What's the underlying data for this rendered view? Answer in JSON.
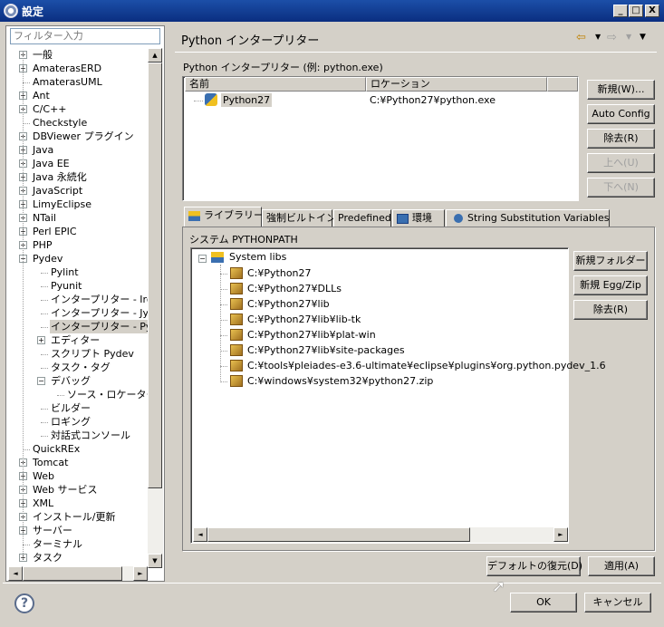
{
  "window": {
    "title": "設定",
    "min": "_",
    "max": "□",
    "close": "X"
  },
  "filter": {
    "placeholder": "フィルター入力"
  },
  "tree": [
    {
      "label": "一般",
      "depth": 0,
      "exp": "+"
    },
    {
      "label": "AmaterasERD",
      "depth": 0,
      "exp": "+"
    },
    {
      "label": "AmaterasUML",
      "depth": 0,
      "exp": ""
    },
    {
      "label": "Ant",
      "depth": 0,
      "exp": "+"
    },
    {
      "label": "C/C++",
      "depth": 0,
      "exp": "+"
    },
    {
      "label": "Checkstyle",
      "depth": 0,
      "exp": ""
    },
    {
      "label": "DBViewer プラグイン",
      "depth": 0,
      "exp": "+"
    },
    {
      "label": "Java",
      "depth": 0,
      "exp": "+"
    },
    {
      "label": "Java EE",
      "depth": 0,
      "exp": "+"
    },
    {
      "label": "Java 永続化",
      "depth": 0,
      "exp": "+"
    },
    {
      "label": "JavaScript",
      "depth": 0,
      "exp": "+"
    },
    {
      "label": "LimyEclipse",
      "depth": 0,
      "exp": "+"
    },
    {
      "label": "NTail",
      "depth": 0,
      "exp": "+"
    },
    {
      "label": "Perl EPIC",
      "depth": 0,
      "exp": "+"
    },
    {
      "label": "PHP",
      "depth": 0,
      "exp": "+"
    },
    {
      "label": "Pydev",
      "depth": 0,
      "exp": "-"
    },
    {
      "label": "Pylint",
      "depth": 1,
      "exp": ""
    },
    {
      "label": "Pyunit",
      "depth": 1,
      "exp": ""
    },
    {
      "label": "インタープリター - Iron",
      "depth": 1,
      "exp": ""
    },
    {
      "label": "インタープリター - Jyth",
      "depth": 1,
      "exp": ""
    },
    {
      "label": "インタープリター - Pyth",
      "depth": 1,
      "exp": "",
      "selected": true
    },
    {
      "label": "エディター",
      "depth": 1,
      "exp": "+"
    },
    {
      "label": "スクリプト Pydev",
      "depth": 1,
      "exp": ""
    },
    {
      "label": "タスク・タグ",
      "depth": 1,
      "exp": ""
    },
    {
      "label": "デバッグ",
      "depth": 1,
      "exp": "-"
    },
    {
      "label": "ソース・ロケーター",
      "depth": 2,
      "exp": ""
    },
    {
      "label": "ビルダー",
      "depth": 1,
      "exp": ""
    },
    {
      "label": "ロギング",
      "depth": 1,
      "exp": ""
    },
    {
      "label": "対話式コンソール",
      "depth": 1,
      "exp": ""
    },
    {
      "label": "QuickREx",
      "depth": 0,
      "exp": ""
    },
    {
      "label": "Tomcat",
      "depth": 0,
      "exp": "+"
    },
    {
      "label": "Web",
      "depth": 0,
      "exp": "+"
    },
    {
      "label": "Web サービス",
      "depth": 0,
      "exp": "+"
    },
    {
      "label": "XML",
      "depth": 0,
      "exp": "+"
    },
    {
      "label": "インストール/更新",
      "depth": 0,
      "exp": "+"
    },
    {
      "label": "サーバー",
      "depth": 0,
      "exp": "+"
    },
    {
      "label": "ターミナル",
      "depth": 0,
      "exp": ""
    },
    {
      "label": "タスク",
      "depth": 0,
      "exp": "+"
    }
  ],
  "page": {
    "title": "Python インタープリター"
  },
  "interp": {
    "group_label": "Python インタープリター (例: python.exe)",
    "col_name": "名前",
    "col_location": "ロケーション",
    "rows": [
      {
        "name": "Python27",
        "location": "C:¥Python27¥python.exe"
      }
    ],
    "buttons": {
      "new": "新規(W)...",
      "auto": "Auto Config",
      "remove": "除去(R)",
      "up": "上へ(U)",
      "down": "下へ(N)"
    }
  },
  "tabs": [
    "ライブラリー",
    "強制ビルトイン",
    "Predefined",
    "環境",
    "String Substitution Variables"
  ],
  "libs": {
    "label": "システム PYTHONPATH",
    "root": "System libs",
    "paths": [
      "C:¥Python27",
      "C:¥Python27¥DLLs",
      "C:¥Python27¥lib",
      "C:¥Python27¥lib¥lib-tk",
      "C:¥Python27¥lib¥plat-win",
      "C:¥Python27¥lib¥site-packages",
      "C:¥tools¥pleiades-e3.6-ultimate¥eclipse¥plugins¥org.python.pydev_1.6",
      "C:¥windows¥system32¥python27.zip"
    ],
    "buttons": {
      "new_folder": "新規フォルダー",
      "new_egg": "新規 Egg/Zip",
      "remove": "除去(R)"
    }
  },
  "footer": {
    "restore": "デフォルトの復元(D)",
    "apply": "適用(A)",
    "ok": "OK",
    "cancel": "キャンセル",
    "help": "?"
  },
  "colors": {
    "title_bar": "#0a2e80",
    "dialog": "#d4d0c8"
  }
}
